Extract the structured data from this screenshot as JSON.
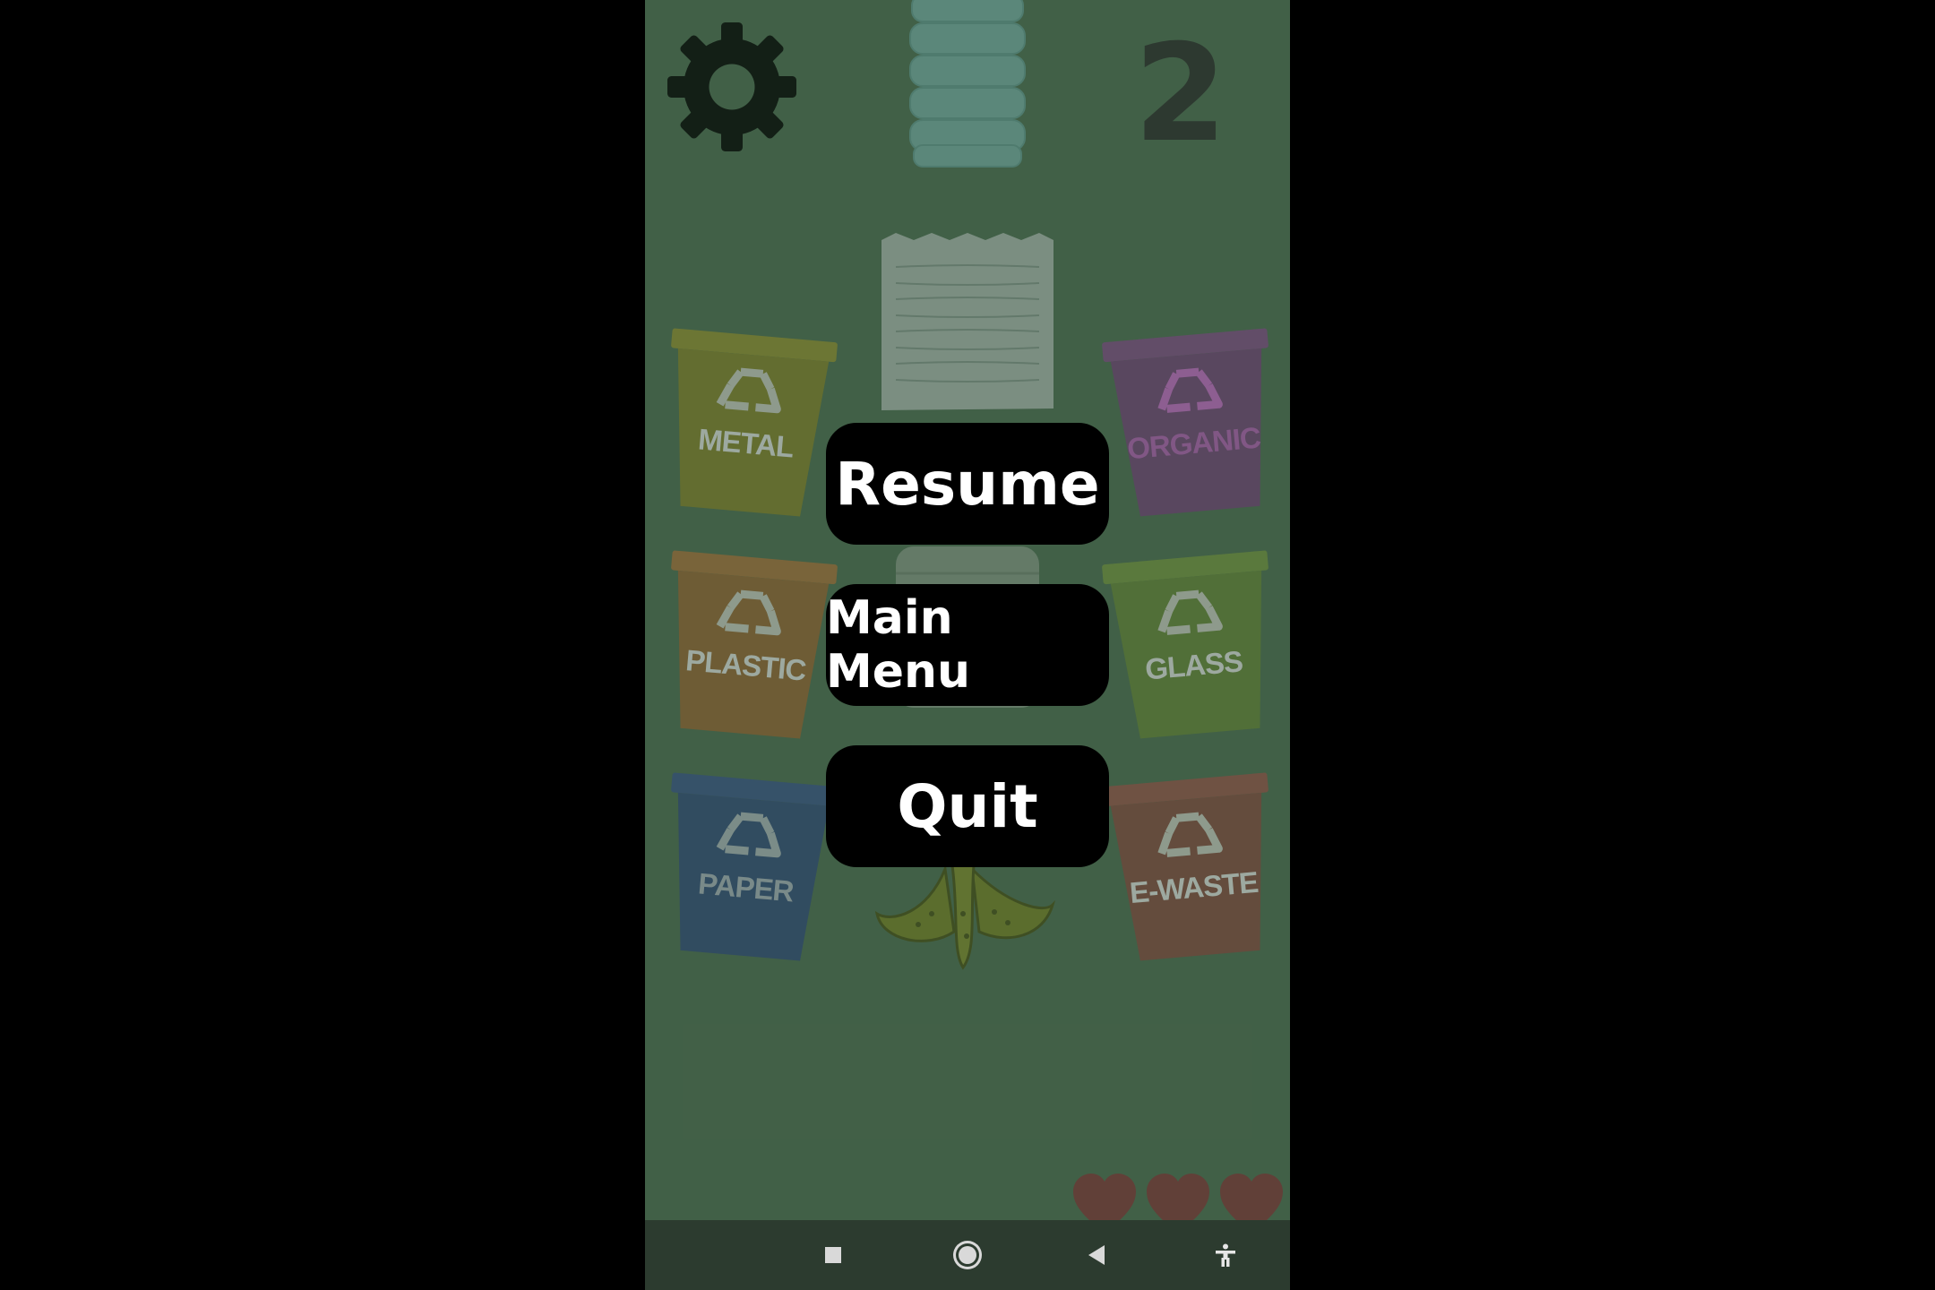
{
  "game": {
    "score": "2",
    "lives": 3,
    "bins": [
      {
        "id": "metal",
        "label": "METAL",
        "color": "#8d8a2e",
        "rim": "#a39f3a"
      },
      {
        "id": "organic",
        "label": "ORGANIC",
        "color": "#7b4780",
        "rim": "#8c5291"
      },
      {
        "id": "plastic",
        "label": "PLASTIC",
        "color": "#a06c38",
        "rim": "#b37a40"
      },
      {
        "id": "glass",
        "label": "GLASS",
        "color": "#6e8d3c",
        "rim": "#7e9f46"
      },
      {
        "id": "paper",
        "label": "PAPER",
        "color": "#364f82",
        "rim": "#3f5b93"
      },
      {
        "id": "ewaste",
        "label": "E-WASTE",
        "color": "#8f4f45",
        "rim": "#a25b4f"
      }
    ],
    "items": [
      "bottle",
      "paper",
      "can",
      "banana-peel"
    ]
  },
  "pause_menu": {
    "resume_label": "Resume",
    "main_menu_label": "Main Menu",
    "quit_label": "Quit"
  },
  "navbar": {
    "icons": [
      "recents-icon",
      "home-icon",
      "back-icon",
      "accessibility-icon"
    ]
  },
  "colors": {
    "background": "#527257",
    "button": "#000000",
    "heart": "#8a3a3c"
  }
}
